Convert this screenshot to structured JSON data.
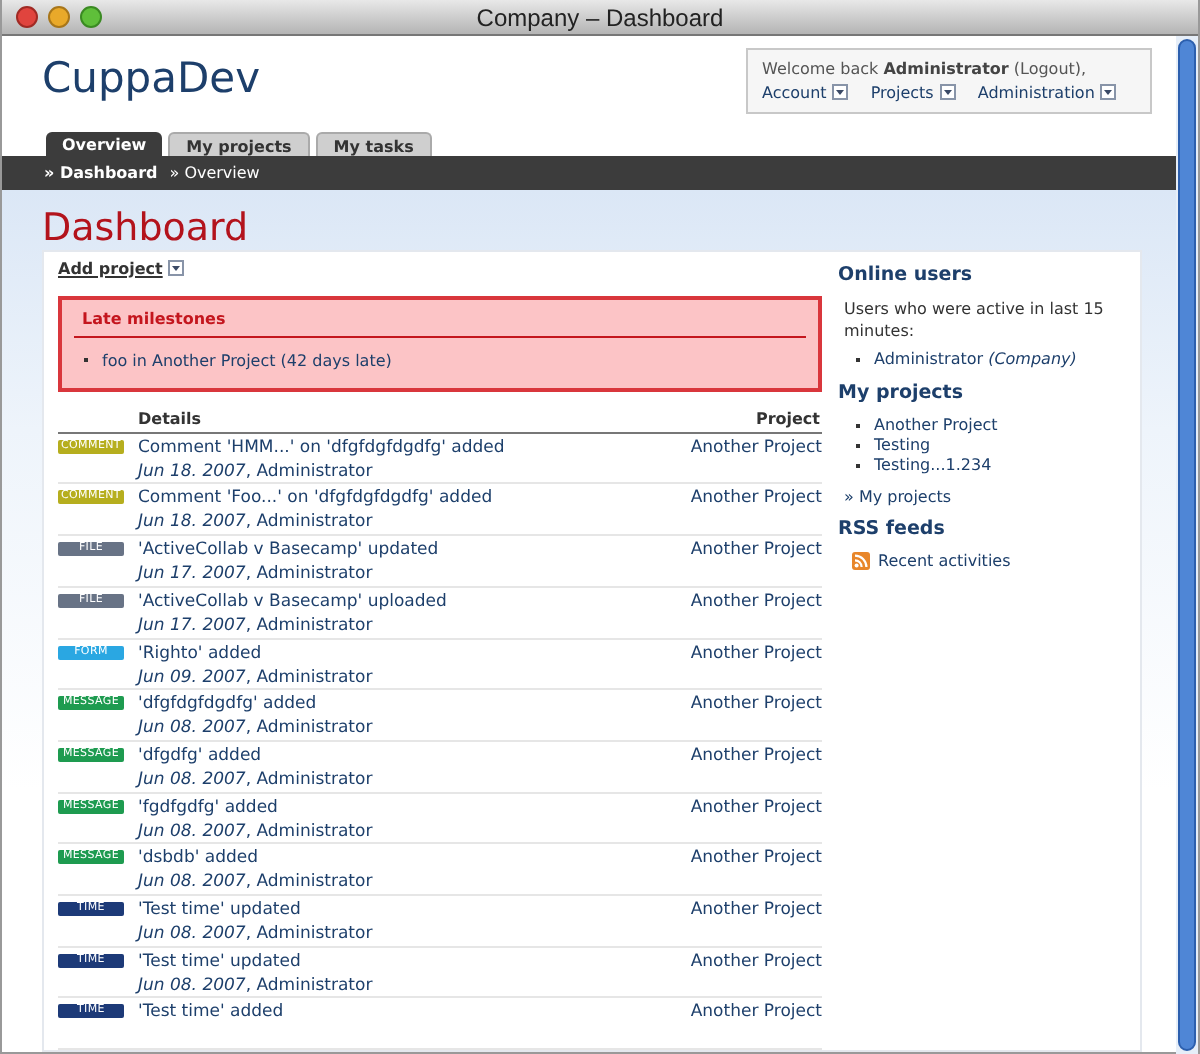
{
  "window": {
    "title": "Company – Dashboard"
  },
  "header": {
    "logo": "CuppaDev",
    "welcome": "Welcome back **Administrator** (Logout),",
    "menus": [
      {
        "label": "Account"
      },
      {
        "label": "Projects"
      },
      {
        "label": "Administration"
      }
    ]
  },
  "tabs": [
    {
      "label": "Overview",
      "selected": true
    },
    {
      "label": "My projects",
      "selected": false
    },
    {
      "label": "My tasks",
      "selected": false
    }
  ],
  "breadcrumb": [
    "» Dashboard",
    "» Overview"
  ],
  "page_title": "Dashboard",
  "add_project": "Add project",
  "late_milestones": {
    "title": "Late milestones",
    "items": [
      "foo in Another Project (42 days late)"
    ]
  },
  "activity": {
    "columns": [
      "Details",
      "Project"
    ],
    "rows": [
      {
        "kind": "comment",
        "badge": "COMMENT",
        "title": "Comment 'HMM...' on 'dfgfdgfdgdfg' added",
        "meta": "*Jun 18. 2007*, Administrator",
        "project": "Another Project"
      },
      {
        "kind": "comment",
        "badge": "COMMENT",
        "title": "Comment 'Foo...' on 'dfgfdgfdgdfg' added",
        "meta": "*Jun 18. 2007*, Administrator",
        "project": "Another Project"
      },
      {
        "kind": "file",
        "badge": "FILE",
        "title": "'ActiveCollab v Basecamp' updated",
        "meta": "*Jun 17. 2007*, Administrator",
        "project": "Another Project"
      },
      {
        "kind": "file",
        "badge": "FILE",
        "title": "'ActiveCollab v Basecamp' uploaded",
        "meta": "*Jun 17. 2007*, Administrator",
        "project": "Another Project"
      },
      {
        "kind": "form",
        "badge": "FORM",
        "title": "'Righto' added",
        "meta": "*Jun 09. 2007*, Administrator",
        "project": "Another Project"
      },
      {
        "kind": "message",
        "badge": "MESSAGE",
        "title": "'dfgfdgfdgdfg' added",
        "meta": "*Jun 08. 2007*, Administrator",
        "project": "Another Project"
      },
      {
        "kind": "message",
        "badge": "MESSAGE",
        "title": "'dfgdfg' added",
        "meta": "*Jun 08. 2007*, Administrator",
        "project": "Another Project"
      },
      {
        "kind": "message",
        "badge": "MESSAGE",
        "title": "'fgdfgdfg' added",
        "meta": "*Jun 08. 2007*, Administrator",
        "project": "Another Project"
      },
      {
        "kind": "message",
        "badge": "MESSAGE",
        "title": "'dsbdb' added",
        "meta": "*Jun 08. 2007*, Administrator",
        "project": "Another Project"
      },
      {
        "kind": "time",
        "badge": "TIME",
        "title": "'Test time' updated",
        "meta": "*Jun 08. 2007*, Administrator",
        "project": "Another Project"
      },
      {
        "kind": "time",
        "badge": "TIME",
        "title": "'Test time' updated",
        "meta": "*Jun 08. 2007*, Administrator",
        "project": "Another Project"
      },
      {
        "kind": "time",
        "badge": "TIME",
        "title": "'Test time' added",
        "project": "Another Project"
      }
    ]
  },
  "sidebar": {
    "online_users": {
      "title": "Online users",
      "note": "Users who were active in last 15 minutes:",
      "users": [
        "Administrator *(Company)*"
      ]
    },
    "my_projects": {
      "title": "My projects",
      "items": [
        "Another Project",
        "Testing",
        "Testing...1.234"
      ],
      "more": "» My projects"
    },
    "rss": {
      "title": "RSS feeds",
      "items": [
        "Recent activities"
      ]
    }
  }
}
